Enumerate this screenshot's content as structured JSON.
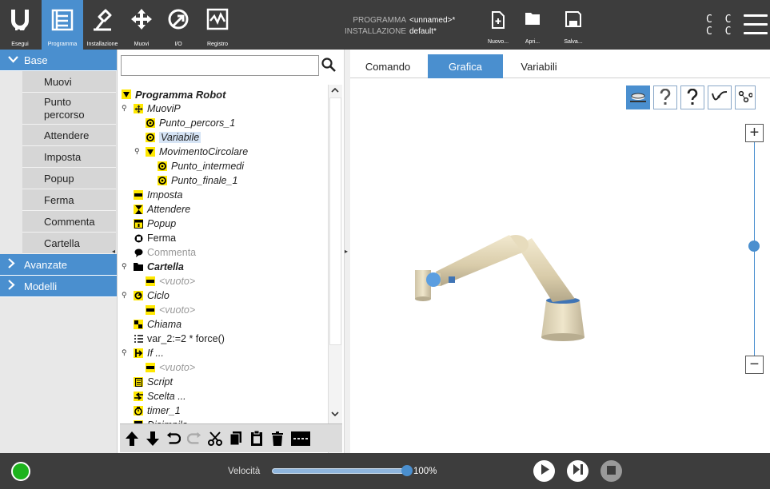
{
  "topbar": {
    "logo_text": "UR",
    "nav": [
      {
        "label": "Esegui",
        "icon": "ur-logo-icon"
      },
      {
        "label": "Programma",
        "icon": "program-icon",
        "active": true
      },
      {
        "label": "Installazione",
        "icon": "installation-icon"
      },
      {
        "label": "Muovi",
        "icon": "move-icon"
      },
      {
        "label": "I/O",
        "icon": "io-icon"
      },
      {
        "label": "Registro",
        "icon": "log-icon"
      }
    ],
    "program_key": "PROGRAMMA",
    "program_value": "<unnamed>*",
    "installation_key": "INSTALLAZIONE",
    "installation_value": "default*",
    "file_buttons": [
      {
        "label": "Nuovo...",
        "icon": "new-file-icon"
      },
      {
        "label": "Apri...",
        "icon": "open-folder-icon"
      },
      {
        "label": "Salva...",
        "icon": "save-icon"
      }
    ],
    "cc_line1": "C C",
    "cc_line2": "C C",
    "menu_icon": "hamburger-menu-icon",
    "accent": "#4a8fcf"
  },
  "left_panel": {
    "base_label": "Base",
    "commands": [
      "Muovi",
      "Punto percorso",
      "Attendere",
      "Imposta",
      "Popup",
      "Ferma",
      "Commenta",
      "Cartella"
    ],
    "advanced_label": "Avanzate",
    "templates_label": "Modelli"
  },
  "tree": {
    "root": "Programma Robot",
    "nodes": [
      {
        "text": "MuoviP",
        "icon": "move-icon"
      },
      {
        "text": "Punto_percors_1",
        "icon": "waypoint-icon"
      },
      {
        "text": "Variabile",
        "icon": "waypoint-icon"
      },
      {
        "text": "MovimentoCircolare",
        "icon": "collapse-icon"
      },
      {
        "text": "Punto_intermedi",
        "icon": "waypoint-icon"
      },
      {
        "text": "Punto_finale_1",
        "icon": "waypoint-icon"
      },
      {
        "text": "Imposta",
        "icon": "set-icon"
      },
      {
        "text": "Attendere",
        "icon": "hourglass-icon"
      },
      {
        "text": "Popup",
        "icon": "popup-icon"
      },
      {
        "text": "Ferma",
        "icon": "stop-hand-icon"
      },
      {
        "text": "Commenta",
        "icon": "comment-icon"
      },
      {
        "text": "Cartella",
        "icon": "folder-icon"
      },
      {
        "text": "<vuoto>",
        "icon": "empty-icon"
      },
      {
        "text": "Ciclo",
        "icon": "loop-icon"
      },
      {
        "text": "<vuoto>",
        "icon": "empty-icon"
      },
      {
        "text": "Chiama",
        "icon": "call-icon"
      },
      {
        "text": "var_2:=2 * force()",
        "icon": "assignment-icon"
      },
      {
        "text": "If ...",
        "icon": "if-icon"
      },
      {
        "text": "<vuoto>",
        "icon": "empty-icon"
      },
      {
        "text": "Script",
        "icon": "script-icon"
      },
      {
        "text": "Scelta ...",
        "icon": "switch-icon"
      },
      {
        "text": "timer_1",
        "icon": "timer-icon"
      },
      {
        "text": "Disimpila",
        "icon": "pallet-icon"
      }
    ]
  },
  "tabs": [
    "Comando",
    "Grafica",
    "Variabili"
  ],
  "active_tab": "Grafica",
  "view_buttons": [
    "floor-view-icon",
    "help-icon",
    "help-icon",
    "path-icon",
    "joints-icon"
  ],
  "bottombar": {
    "speed_label": "Velocità",
    "speed_value": "100%",
    "speed_fraction": 1.0,
    "status_color": "#1db31d"
  }
}
